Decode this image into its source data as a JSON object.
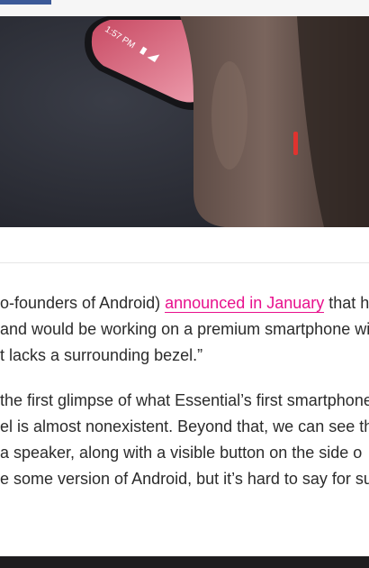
{
  "hero": {
    "image_subject": "hand-holding-phone-photo",
    "status_time": "1:57 PM"
  },
  "article": {
    "paragraph1": {
      "line1_before": "o-founders of Android) ",
      "link_text": "announced in January",
      "line1_after": " that he",
      "line2": "and would be working on a premium smartphone wi",
      "line3": "t lacks a surrounding bezel.”"
    },
    "paragraph2": {
      "line1": "the first glimpse of what Essential’s first smartphone",
      "line2": "el is almost nonexistent. Beyond that, we can see th",
      "line3": " a speaker, along with a visible button on the side o",
      "line4": "e some version of Android, but it’s hard to say for sur"
    }
  },
  "colors": {
    "link": "#e8118d",
    "share_bar": "#3b5998",
    "text": "#2b2b2b"
  }
}
